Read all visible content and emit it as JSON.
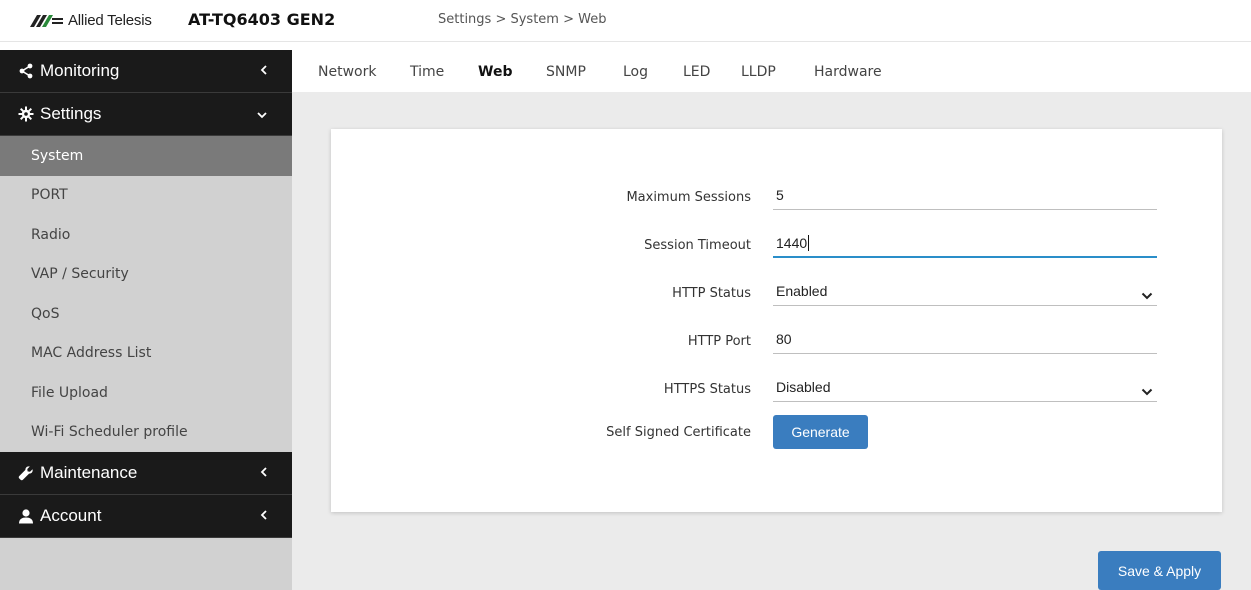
{
  "header": {
    "logo_text": "Allied Telesis",
    "model": "AT-TQ6403 GEN2",
    "breadcrumb": "Settings > System > Web"
  },
  "sidebar": {
    "sections": [
      {
        "label": "Monitoring",
        "icon": "share-icon",
        "chevron": "‹"
      },
      {
        "label": "Settings",
        "icon": "gear-icon",
        "chevron": "⌄"
      },
      {
        "label": "Maintenance",
        "icon": "wrench-icon",
        "chevron": "‹"
      },
      {
        "label": "Account",
        "icon": "user-icon",
        "chevron": "‹"
      }
    ],
    "settings_items": [
      {
        "label": "System",
        "active": true
      },
      {
        "label": "PORT"
      },
      {
        "label": "Radio"
      },
      {
        "label": "VAP / Security"
      },
      {
        "label": "QoS"
      },
      {
        "label": "MAC Address List"
      },
      {
        "label": "File Upload"
      },
      {
        "label": "Wi-Fi Scheduler profile"
      }
    ]
  },
  "tabs": [
    {
      "label": "Network"
    },
    {
      "label": "Time"
    },
    {
      "label": "Web",
      "active": true
    },
    {
      "label": "SNMP"
    },
    {
      "label": "Log"
    },
    {
      "label": "LED"
    },
    {
      "label": "LLDP"
    },
    {
      "label": "Hardware"
    }
  ],
  "form": {
    "max_sessions": {
      "label": "Maximum Sessions",
      "value": "5"
    },
    "session_timeout": {
      "label": "Session Timeout",
      "value": "1440"
    },
    "http_status": {
      "label": "HTTP Status",
      "value": "Enabled"
    },
    "http_port": {
      "label": "HTTP Port",
      "value": "80"
    },
    "https_status": {
      "label": "HTTPS Status",
      "value": "Disabled"
    },
    "self_signed": {
      "label": "Self Signed Certificate",
      "button": "Generate"
    }
  },
  "actions": {
    "save_apply": "Save & Apply"
  },
  "colors": {
    "accent": "#3a7dbf",
    "focus": "#2a8ec9",
    "nav_dark": "#1a1a1a",
    "nav_active": "#7a7a7a",
    "sidebar_bg": "#d1d1d1"
  }
}
